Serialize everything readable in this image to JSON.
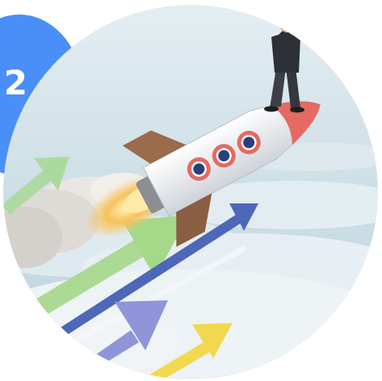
{
  "step_badge": {
    "number": "2",
    "color": "#4a8ff7"
  },
  "hero_image": {
    "icons": [
      "rocket-icon",
      "businessman-icon",
      "arrow-icon"
    ],
    "colors": {
      "sky": "#c9dde6",
      "cloud": "#eef4f7",
      "rocket_body": "#f1f1f3",
      "rocket_nose": "#e46a62",
      "rocket_fins": "#9b6b4b",
      "flame": "#f7c25a",
      "arrow_green": "#a9d99b",
      "arrow_blue": "#4e67b8",
      "arrow_purple": "#8f95d8",
      "arrow_yellow": "#f2d84e"
    }
  }
}
